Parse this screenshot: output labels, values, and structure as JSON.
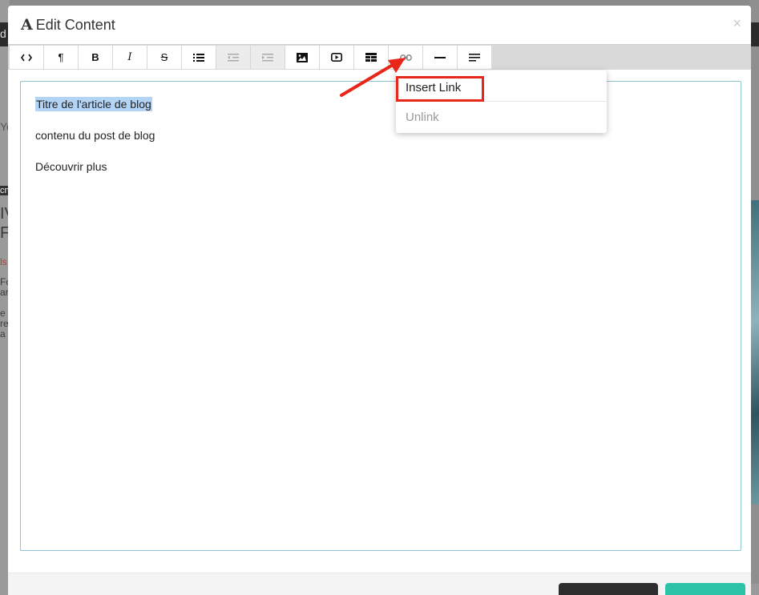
{
  "background": {
    "fragments": [
      "d",
      "Yo",
      "cn",
      "IV",
      "F",
      "ls",
      "Fo",
      "ar",
      "e",
      "re",
      "a"
    ]
  },
  "modal": {
    "title": "Edit Content",
    "title_icon": "font-icon",
    "close_label": "×"
  },
  "toolbar": {
    "tools": [
      {
        "name": "code-view-icon",
        "glyph": "<>",
        "enabled": true
      },
      {
        "name": "paragraph-icon",
        "glyph": "¶",
        "enabled": true
      },
      {
        "name": "bold-icon",
        "glyph": "B",
        "enabled": true
      },
      {
        "name": "italic-icon",
        "glyph": "I",
        "enabled": true
      },
      {
        "name": "strikethrough-icon",
        "glyph": "S",
        "enabled": true
      },
      {
        "name": "list-icon",
        "glyph": "list",
        "enabled": true
      },
      {
        "name": "outdent-icon",
        "glyph": "outdent",
        "enabled": false
      },
      {
        "name": "indent-icon",
        "glyph": "indent",
        "enabled": false
      },
      {
        "name": "image-icon",
        "glyph": "image",
        "enabled": true
      },
      {
        "name": "video-icon",
        "glyph": "video",
        "enabled": true
      },
      {
        "name": "table-icon",
        "glyph": "table",
        "enabled": true
      },
      {
        "name": "link-icon",
        "glyph": "link",
        "enabled": true
      },
      {
        "name": "horizontal-rule-icon",
        "glyph": "hr",
        "enabled": true
      },
      {
        "name": "align-icon",
        "glyph": "align",
        "enabled": true
      }
    ]
  },
  "editor": {
    "paragraphs": [
      "Titre de l'article de blog",
      "contenu du post de blog",
      "Découvrir plus"
    ]
  },
  "link_menu": {
    "insert_label": "Insert Link",
    "unlink_label": "Unlink"
  },
  "colors": {
    "highlight": "#e8261a",
    "selection": "#b4d4f5",
    "editor_border": "#8cc5cf",
    "primary_button": "#2cc3a8"
  }
}
